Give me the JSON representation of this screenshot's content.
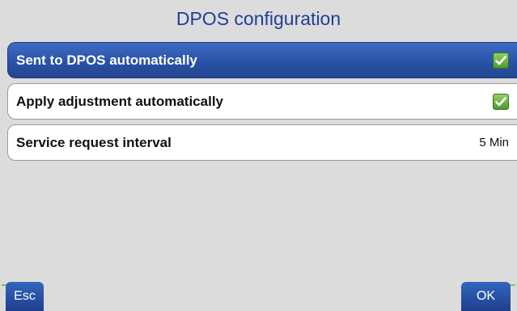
{
  "header": {
    "title": "DPOS configuration"
  },
  "settings": {
    "items": [
      {
        "label": "Sent to DPOS automatically",
        "checked": true,
        "selected": true
      },
      {
        "label": "Apply adjustment automatically",
        "checked": true,
        "selected": false
      },
      {
        "label": "Service request interval",
        "value": "5 Min",
        "selected": false
      }
    ]
  },
  "footer": {
    "esc_label": "Esc",
    "ok_label": "OK"
  },
  "colors": {
    "title": "#1f3f96",
    "selected_row": "#2a52a6",
    "checkbox": "#5fae38",
    "background": "#dcdcdc"
  },
  "icons": {
    "checkbox": "check-icon"
  }
}
